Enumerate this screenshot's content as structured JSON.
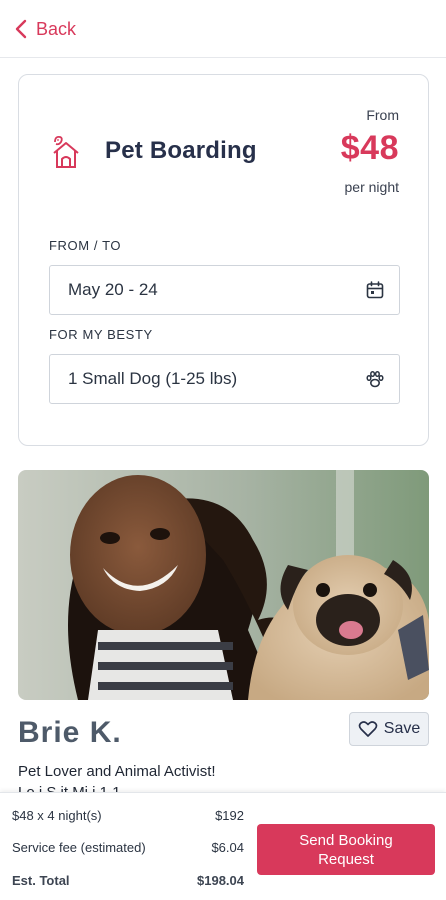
{
  "header": {
    "back_label": "Back"
  },
  "service": {
    "title": "Pet Boarding",
    "price_prefix": "From",
    "price": "$48",
    "price_unit": "per night"
  },
  "booking": {
    "dates_label": "FROM / TO",
    "dates_value": "May 20 - 24",
    "pet_label": "FOR MY BESTY",
    "pet_value": "1 Small Dog (1-25 lbs)"
  },
  "sitter": {
    "name": "Brie K.",
    "save_label": "Save",
    "tagline": "Pet Lover and Animal Activist!",
    "tagline_partial": "Lo i S   it Mi     i 1  1 "
  },
  "summary": {
    "rows": [
      {
        "label": "$48 x 4 night(s)",
        "value": "$192"
      },
      {
        "label": "Service fee (estimated)",
        "value": "$6.04"
      },
      {
        "label": "Est. Total",
        "value": "$198.04"
      }
    ],
    "cta_label": "Send Booking Request"
  },
  "colors": {
    "accent": "#d8395b",
    "title": "#27304a",
    "border": "#d9dde3"
  },
  "icons": {
    "back": "chevron-left-icon",
    "service": "pet-house-icon",
    "calendar": "calendar-icon",
    "paw": "paw-icon",
    "save": "heart-icon"
  }
}
